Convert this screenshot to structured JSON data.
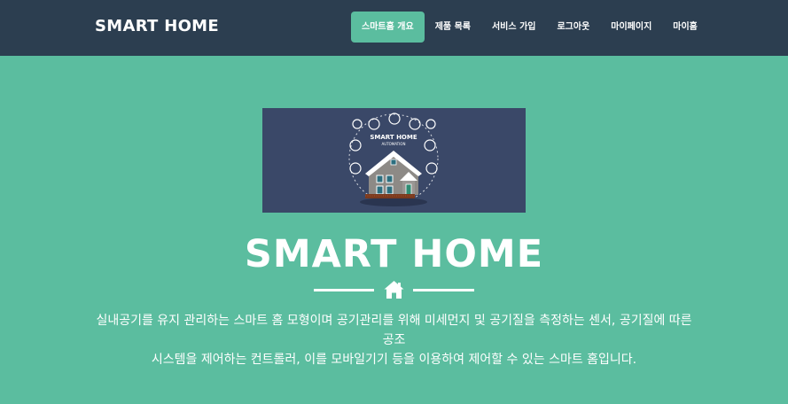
{
  "navbar": {
    "brand": "SMART HOME",
    "items": [
      {
        "label": "스마트홈 개요",
        "active": true
      },
      {
        "label": "제품 목록"
      },
      {
        "label": "서비스 가입"
      },
      {
        "label": "로그아웃"
      },
      {
        "label": "마이페이지"
      },
      {
        "label": "마이홈"
      }
    ]
  },
  "hero": {
    "image": {
      "title": "SMART HOME",
      "subtitle": "AUTOMATION"
    },
    "title": "SMART HOME",
    "divider_icon": "home-icon",
    "description_line1": "실내공기를 유지 관리하는 스마트 홈 모형이며 공기관리를 위해 미세먼지 및 공기질을 측정하는 센서, 공기질에 따른 공조",
    "description_line2": "시스템을 제어하는 컨트롤러, 이를 모바일기기 등을 이용하여 제어할 수 있는 스마트 홈입니다."
  },
  "colors": {
    "navbar_bg": "#2c3e50",
    "accent": "#5bbd9f",
    "image_bg": "#3a4868",
    "text": "#ffffff"
  }
}
